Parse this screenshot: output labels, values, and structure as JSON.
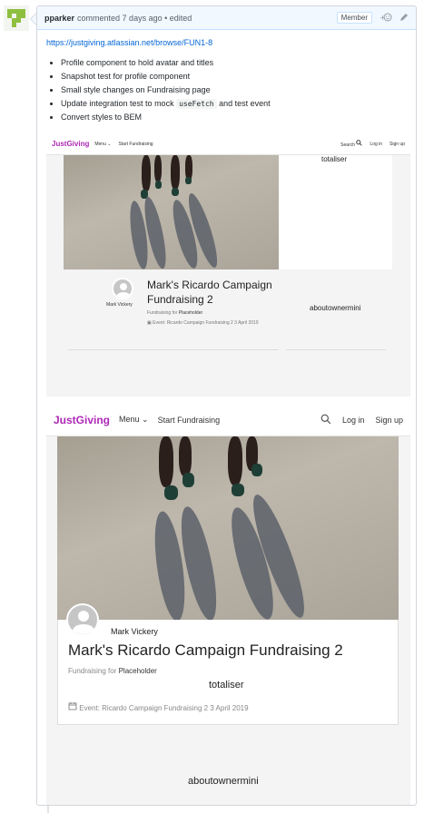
{
  "comment": {
    "author": "pparker",
    "meta": "commented 7 days ago • edited",
    "badge": "Member",
    "reaction_icon": "smiley-icon",
    "edit_icon": "pencil-icon",
    "link": "https://justgiving.atlassian.net/browse/FUN1-8",
    "bullets": [
      {
        "text": "Profile component to hold avatar and titles"
      },
      {
        "text": "Snapshot test for profile component"
      },
      {
        "text": "Small style changes on Fundraising page"
      },
      {
        "pre": "Update integration test to mock ",
        "code": "useFetch",
        "post": " and test event"
      },
      {
        "text": "Convert styles to BEM"
      }
    ]
  },
  "shot1": {
    "logo": "JustGiving",
    "menu": "Menu",
    "start": "Start Fundraising",
    "search": "Search",
    "login": "Log in",
    "signup": "Sign up",
    "totaliser": "totaliser",
    "owner_name": "Mark Vickery",
    "title_line1": "Mark's Ricardo Campaign",
    "title_line2": "Fundraising 2",
    "fundraising_for": "Fundraising for",
    "placeholder": "Placeholder",
    "event": "Event: Ricardo Campaign Fundraising 2 3 April 2019",
    "aboutowner": "aboutownermini"
  },
  "shot2": {
    "logo": "JustGiving",
    "menu": "Menu",
    "start": "Start Fundraising",
    "login": "Log in",
    "signup": "Sign up",
    "owner_name": "Mark Vickery",
    "title": "Mark's Ricardo Campaign Fundraising 2",
    "fundraising_for": "Fundraising for",
    "placeholder": "Placeholder",
    "totaliser": "totaliser",
    "event": "Event: Ricardo Campaign Fundraising 2 3 April 2019",
    "aboutowner": "aboutownermini"
  },
  "colors": {
    "brand": "#ad29b6",
    "link": "#0366d6",
    "header_bg": "#f1f8ff",
    "avatar_green": "#8fbf3f"
  }
}
